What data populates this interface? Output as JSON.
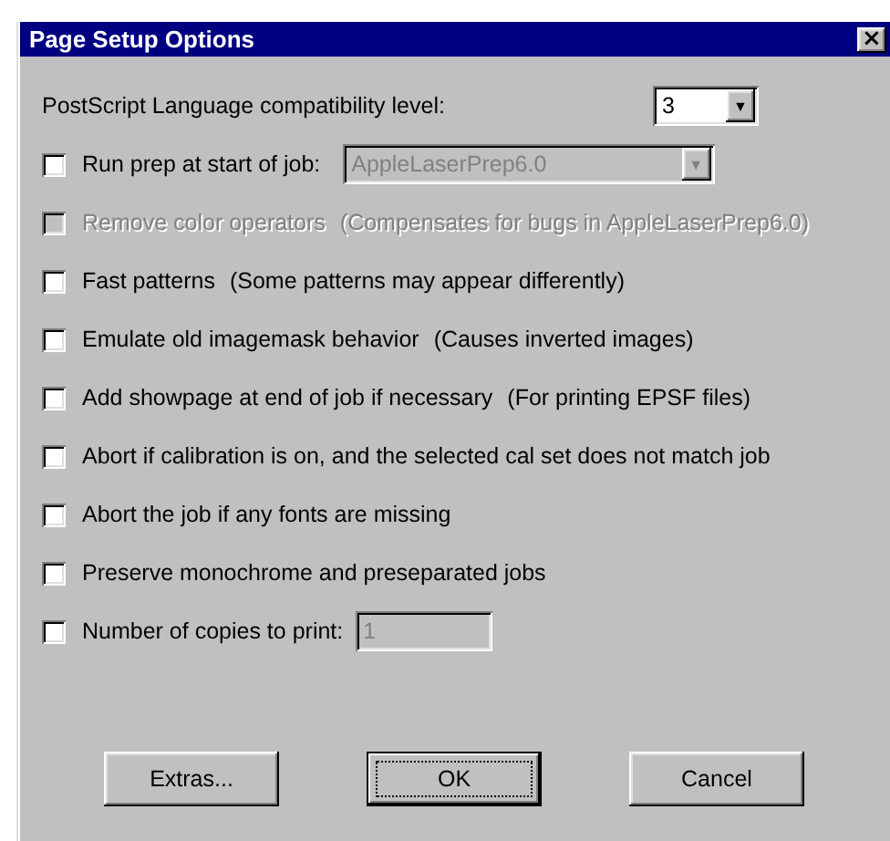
{
  "window": {
    "title": "Page Setup Options",
    "close": "×"
  },
  "level_row": {
    "label": "PostScript Language compatibility level:",
    "value": "3",
    "arrow": "▼"
  },
  "options": [
    {
      "kind": "combo",
      "label": "Run prep at start of job:",
      "checked": false,
      "disabled": false,
      "value": "AppleLaserPrep6.0",
      "value_disabled": true,
      "arrow": "▼"
    },
    {
      "kind": "plain",
      "label": "Remove color operators",
      "note": "(Compensates for bugs in AppleLaserPrep6.0)",
      "checked": false,
      "disabled": true
    },
    {
      "kind": "plain",
      "label": "Fast patterns",
      "note": "(Some patterns may appear differently)",
      "checked": false,
      "disabled": false
    },
    {
      "kind": "plain",
      "label": "Emulate old imagemask behavior",
      "note": "(Causes inverted images)",
      "checked": false,
      "disabled": false
    },
    {
      "kind": "plain",
      "label": "Add showpage at end of job if necessary",
      "note": "(For printing EPSF files)",
      "checked": false,
      "disabled": false
    },
    {
      "kind": "plain",
      "label": "Abort if calibration is on, and the selected cal set does not match job",
      "checked": false,
      "disabled": false
    },
    {
      "kind": "plain",
      "label": "Abort the job if any fonts are missing",
      "checked": false,
      "disabled": false
    },
    {
      "kind": "plain",
      "label": "Preserve monochrome and preseparated jobs",
      "checked": false,
      "disabled": false
    },
    {
      "kind": "field",
      "label": "Number of copies to print:",
      "checked": false,
      "disabled": false,
      "value": "1",
      "value_disabled": true
    }
  ],
  "buttons": [
    {
      "label": "Extras...",
      "default": false
    },
    {
      "label": "OK",
      "default": true
    },
    {
      "label": "Cancel",
      "default": false
    }
  ]
}
